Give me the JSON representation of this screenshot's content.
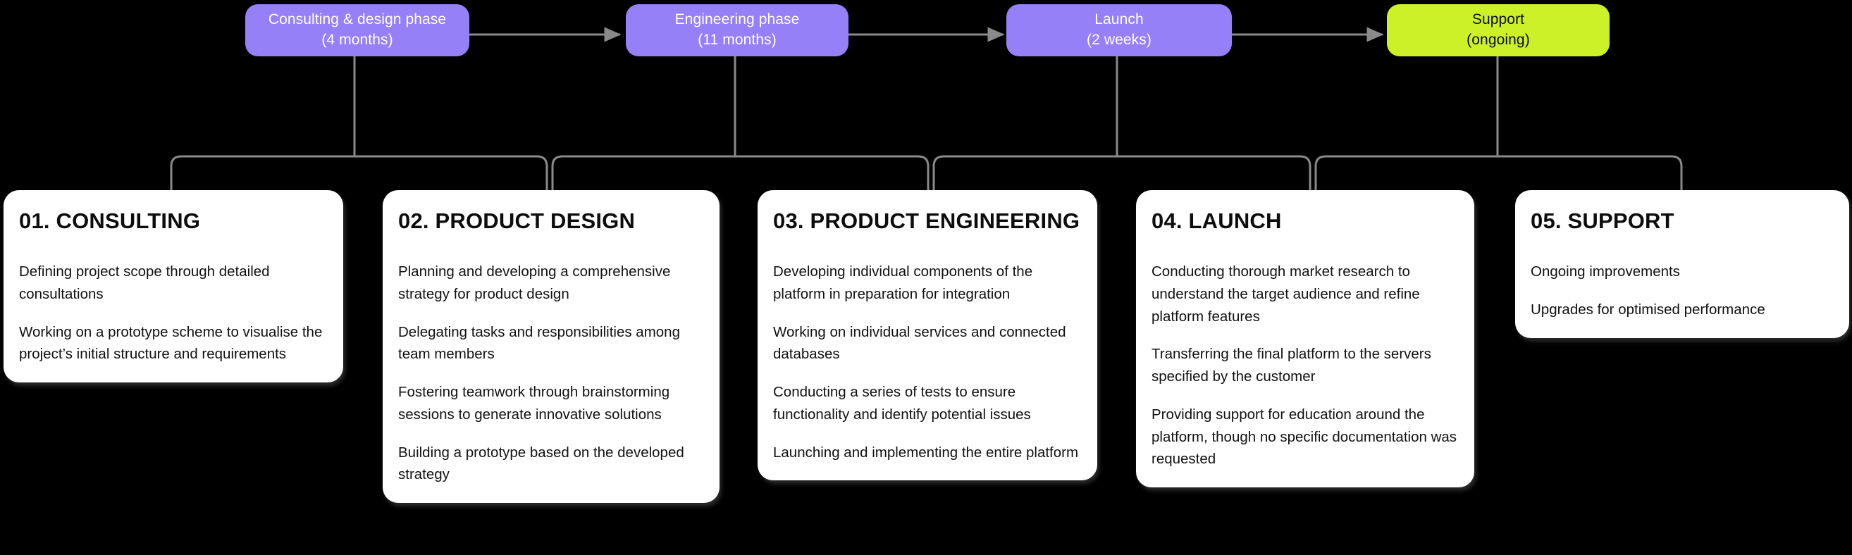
{
  "colors": {
    "background": "#000000",
    "phase_purple": "#9580F7",
    "phase_purple_text": "#FFFFFF",
    "phase_lime": "#CCF129",
    "phase_lime_text": "#0D0D0D",
    "card_background": "#FFFFFF",
    "card_text": "#111111",
    "connector": "#8A8A8A"
  },
  "phases": [
    {
      "name": "Consulting & design phase",
      "duration": "(4 months)",
      "fill": "purple"
    },
    {
      "name": "Engineering phase",
      "duration": "(11 months)",
      "fill": "purple"
    },
    {
      "name": "Launch",
      "duration": "(2 weeks)",
      "fill": "purple"
    },
    {
      "name": "Support",
      "duration": "(ongoing)",
      "fill": "lime"
    }
  ],
  "cards": [
    {
      "title": "01. CONSULTING",
      "bullets": [
        "Defining project scope through detailed consultations",
        "Working on a prototype scheme to visualise the project’s initial structure and requirements"
      ]
    },
    {
      "title": "02. PRODUCT DESIGN",
      "bullets": [
        "Planning and developing a comprehensive strategy for product design",
        "Delegating tasks and responsibilities among team members",
        "Fostering teamwork through brainstorming sessions to generate innovative solutions",
        "Building a prototype based on the developed strategy"
      ]
    },
    {
      "title": "03. PRODUCT ENGINEERING",
      "bullets": [
        "Developing individual components of the platform in preparation for integration",
        "Working on individual services and connected databases",
        "Conducting a series of tests to ensure functionality and identify potential issues",
        "Launching and implementing the entire platform"
      ]
    },
    {
      "title": "04. LAUNCH",
      "bullets": [
        "Conducting thorough market research to understand the target audience and refine platform features",
        "Transferring the final platform to the servers specified by the customer",
        "Providing support for education around the platform, though no specific documentation was requested"
      ]
    },
    {
      "title": "05. SUPPORT",
      "bullets": [
        "Ongoing improvements",
        "Upgrades for optimised performance"
      ]
    }
  ],
  "arrows": [
    {
      "from": "Consulting & design phase",
      "to": "Engineering phase"
    },
    {
      "from": "Engineering phase",
      "to": "Launch"
    },
    {
      "from": "Launch",
      "to": "Support"
    }
  ]
}
